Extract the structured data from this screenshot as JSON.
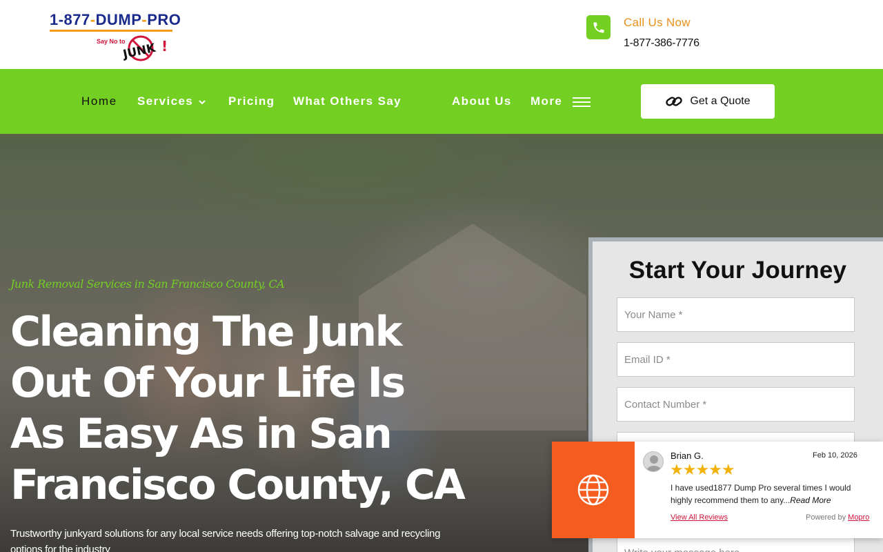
{
  "header": {
    "logo": {
      "line1_a": "1-877",
      "line1_b": "-",
      "line1_c": "DUMP",
      "line1_d": "-",
      "line1_e": "PRO",
      "tagline_small": "Say No to",
      "tagline_big": "JUNK!"
    },
    "call_label": "Call Us Now",
    "call_number": "1-877-386-7776"
  },
  "nav": {
    "items": [
      {
        "label": "Home"
      },
      {
        "label": "Services"
      },
      {
        "label": "Pricing"
      },
      {
        "label": "What Others Say"
      },
      {
        "label": "About Us"
      },
      {
        "label": "More"
      }
    ],
    "quote_label": "Get a Quote"
  },
  "hero": {
    "subtitle": "Junk Removal Services in San Francisco County, CA",
    "title": "Cleaning The Junk Out Of Your Life Is As Easy As in San Francisco County, CA",
    "description": "Trustworthy junkyard solutions for any local service needs offering top-notch salvage and recycling options for the industry"
  },
  "form": {
    "title": "Start Your Journey",
    "name_placeholder": "Your Name *",
    "email_placeholder": "Email ID *",
    "contact_placeholder": "Contact Number *",
    "message_placeholder": "Write your message here..."
  },
  "review": {
    "reviewer": "Brian G.",
    "date": "Feb 10, 2026",
    "rating": 5,
    "stars": "★★★★★",
    "text": "I have used1877 Dump Pro several times I would highly recommend them to any...",
    "read_more": "Read More",
    "view_all": "View All Reviews",
    "powered_by": "Powered by",
    "powered_brand": "Mopro"
  },
  "colors": {
    "brand_green": "#73d022",
    "accent_orange": "#f55c1f",
    "call_label": "#e8901a",
    "star": "#f2b10b"
  },
  "icons": {
    "call": "phone-icon",
    "quote": "link-icon",
    "services": "chevron-down-icon",
    "more": "hamburger-icon",
    "review": "globe-icon"
  }
}
